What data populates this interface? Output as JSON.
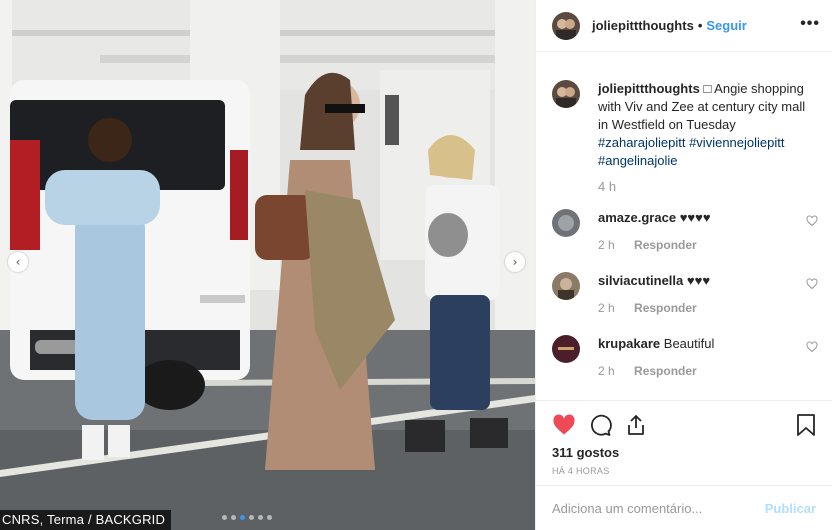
{
  "photo": {
    "credit": "CNRS, Terma / BACKGRID",
    "prev_icon": "chevron-left-icon",
    "next_icon": "chevron-right-icon",
    "carousel_dots": 6,
    "active_dot": 2
  },
  "header": {
    "username": "joliepittthoughts",
    "separator": "•",
    "follow_label": "Seguir",
    "more_icon": "•••"
  },
  "caption": {
    "username": "joliepittthoughts",
    "text": "□ Angie shopping with Viv and Zee at century city mall in Westfield on Tuesday",
    "hashtags": [
      "#zaharajoliepitt",
      "#viviennejoliepitt",
      "#angelinajolie"
    ],
    "time": "4 h"
  },
  "comments": [
    {
      "username": "amaze.grace",
      "text": "♥♥♥♥",
      "time": "2 h",
      "reply": "Responder",
      "avatar_color": "#6f7378"
    },
    {
      "username": "silviacutinella",
      "text": "♥♥♥",
      "time": "2 h",
      "reply": "Responder",
      "avatar_color": "#8a7a66"
    },
    {
      "username": "krupakare",
      "text": "Beautiful",
      "time": "2 h",
      "reply": "Responder",
      "avatar_color": "#4a1e2a"
    }
  ],
  "actions": {
    "likes": "311 gostos",
    "posted_ago": "HÁ 4 HORAS",
    "like_icon": "heart-filled-icon",
    "comment_icon": "comment-bubble-icon",
    "share_icon": "share-icon",
    "save_icon": "bookmark-icon",
    "like_color": "#ed4956"
  },
  "composer": {
    "placeholder": "Adiciona um comentário...",
    "publish_label": "Publicar"
  }
}
